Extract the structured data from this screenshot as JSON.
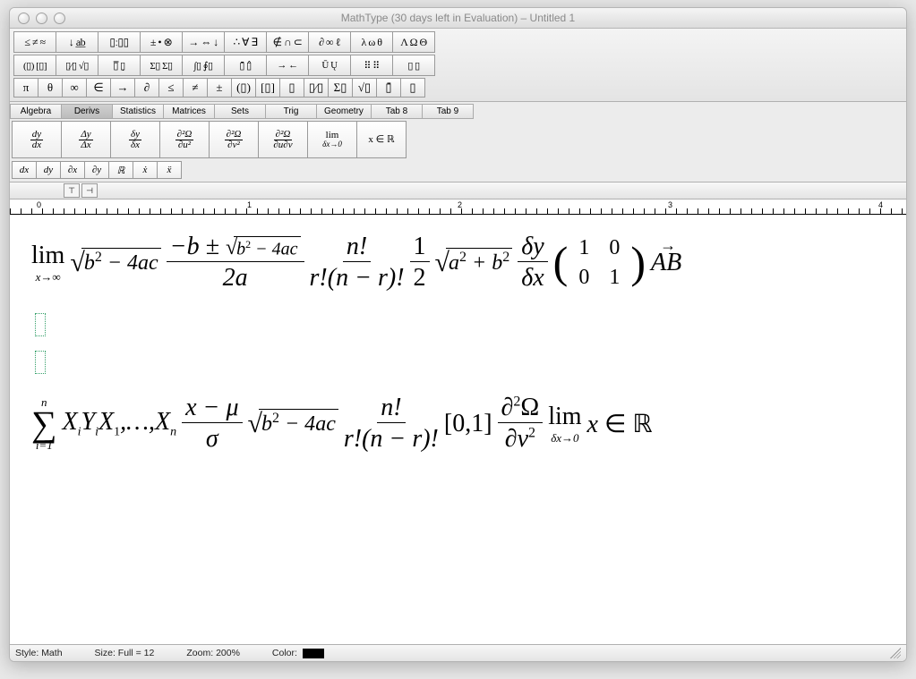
{
  "window": {
    "title": "MathType (30 days left in Evaluation) – Untitled 1"
  },
  "palette_row1": [
    "≤ ≠ ≈",
    "↓ a̲b̲",
    "▯ː▯▯",
    "± • ⊗",
    "→ ⇔ ↓",
    "∴ ∀ ∃",
    "∉ ∩ ⊂",
    "∂ ∞ ℓ",
    "λ ω θ",
    "Λ Ω Θ"
  ],
  "palette_row2": [
    "(▯) [▯]",
    "▯⁄▯ √▯",
    "▯̅ ▯̣",
    "Σ▯ Σ▯",
    "∫▯ ∮▯",
    "▯̄ ▯̂",
    "→ ←",
    "Ū   Ų",
    "⠿ ⠿",
    "▯ ▯"
  ],
  "palette_row3": [
    "π",
    "θ",
    "∞",
    "∈",
    "→",
    "∂",
    "≤",
    "≠",
    "±",
    "(▯)",
    "[▯]",
    "▯",
    "▯⁄▯",
    "Σ▯",
    "√▯",
    "▯̄",
    "▯"
  ],
  "tabs": [
    "Algebra",
    "Derivs",
    "Statistics",
    "Matrices",
    "Sets",
    "Trig",
    "Geometry",
    "Tab 8",
    "Tab 9"
  ],
  "active_tab": 1,
  "templates_big": [
    {
      "num": "dy",
      "den": "dx"
    },
    {
      "num": "Δy",
      "den": "Δx"
    },
    {
      "num": "δy",
      "den": "δx"
    },
    {
      "num": "∂²Ω",
      "den": "∂u²"
    },
    {
      "num": "∂²Ω",
      "den": "∂v²"
    },
    {
      "num": "∂²Ω",
      "den": "∂u∂v"
    },
    {
      "num": "lim",
      "den": "δx→0"
    },
    {
      "plain": "x ∈ ℝ"
    }
  ],
  "templates_small": [
    "dx",
    "dy",
    "∂x",
    "∂y",
    "ℝ",
    "ẋ",
    "ẍ"
  ],
  "ruler_marks": [
    "0",
    "1",
    "2",
    "3",
    "4"
  ],
  "equations": {
    "line1": {
      "lim_sub": "x→∞",
      "sqrt1": "b² − 4ac",
      "quad_num": "−b ± √(b² − 4ac)",
      "quad_den": "2a",
      "binom_num": "n!",
      "binom_den": "r!(n − r)!",
      "half_num": "1",
      "half_den": "2",
      "pyth": "a² + b²",
      "dy_num": "δy",
      "dy_den": "δx",
      "mat": [
        [
          "1",
          "0"
        ],
        [
          "0",
          "1"
        ]
      ],
      "vec": "AB"
    },
    "line2": {
      "sum_top": "n",
      "sum_bot": "i=1",
      "seq": "XᵢYᵢX₁,…,Xₙ",
      "z_num": "x − μ",
      "z_den": "σ",
      "sqrt": "b² − 4ac",
      "binom_num": "n!",
      "binom_den": "r!(n − r)!",
      "interval": "[0,1]",
      "pde_num": "∂²Ω",
      "pde_den": "∂v²",
      "lim_sub": "δx→0",
      "set": "x ∈ ℝ"
    }
  },
  "status": {
    "style_label": "Style:",
    "style_value": "Math",
    "size_label": "Size:",
    "size_value": "Full = 12",
    "zoom_label": "Zoom:",
    "zoom_value": "200%",
    "color_label": "Color:"
  }
}
